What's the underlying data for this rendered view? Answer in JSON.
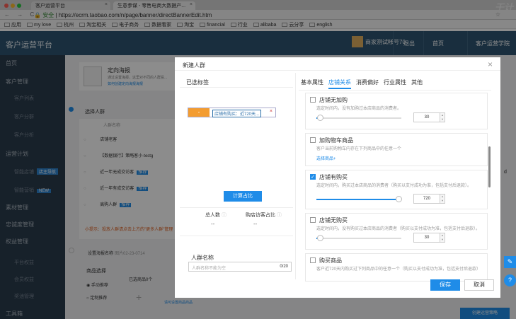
{
  "browser": {
    "tab1_title": "客户运营平台",
    "tab2_title": "生意参谋 - 零售电商大数据产...",
    "tab_close": "×",
    "nav_buttons": "← → C",
    "secure_label": "安全",
    "url": "https://ecrm.taobao.com/n/page/banner/directBannerEdit.htm",
    "watermark": "干计",
    "bookmarks": [
      "应用",
      "my love",
      "杭州",
      "淘宝相关",
      "电子商务",
      "数据看家",
      "淘宝",
      "financial",
      "行业",
      "alibaba",
      "云分享",
      "english"
    ]
  },
  "header": {
    "logo": "客户运营平台",
    "account": "商家测试帐号70",
    "logout": "退出",
    "home": "首页",
    "edu": "客户运营学院"
  },
  "sidebar": {
    "items": [
      {
        "label": "首页"
      },
      {
        "label": "客户管理"
      },
      {
        "label": "客户列表"
      },
      {
        "label": "客户分群"
      },
      {
        "label": "客户分析"
      },
      {
        "label": "运营计划"
      },
      {
        "label": "智能店铺",
        "tag": "店主导航"
      },
      {
        "label": "智能营销",
        "tag": "NEW"
      },
      {
        "label": "素材管理"
      },
      {
        "label": "忠诚度管理"
      },
      {
        "label": "权益管理"
      },
      {
        "label": "平台权益"
      },
      {
        "label": "会员权益"
      },
      {
        "label": "奖池管理"
      },
      {
        "label": "工具箱"
      }
    ]
  },
  "background": {
    "title": "定向海报",
    "desc": "通过设置海报，这里对不同的人群投...",
    "link": "如何创建定向海报海报",
    "select_crowd": "选择人群",
    "crowd_name_col": "人群名称",
    "rows": [
      "店铺老客",
      "【数据银行】策略客小-testg",
      "近一年无成交访客",
      "近一年有成交访客",
      "高购人群"
    ],
    "row_tags": [
      "",
      "",
      "推荐",
      "推荐",
      "推荐"
    ],
    "warn": "小提示：投放人群请点击上方的\"更多人群\"管理",
    "poster_name_label": "设置海报名称",
    "poster_name_value": "图片02-23-0714",
    "product_select": "商品选择",
    "manual": "手动推荐",
    "custom": "定制推荐",
    "selected": "已选商品0个",
    "edit_link": "请可设置商品商品",
    "create_btn": "创建运营策略",
    "side_letter": "d"
  },
  "modal": {
    "title": "新建人群",
    "close": "×",
    "selected_tags_title": "已选标签",
    "chip_tag": "店铺有购买：近720天...",
    "chip_remove": "×",
    "calc_button": "计算占比",
    "total_label": "总人数",
    "ratio_label": "购店访客占比",
    "total_value": "--",
    "ratio_value": "--",
    "name_label": "人群名称",
    "name_placeholder": "人群名称不能为空",
    "name_count": "0/20",
    "tabs": [
      "基本属性",
      "店铺关系",
      "消费偏好",
      "行业属性",
      "其他"
    ],
    "active_tab": 1,
    "cards": [
      {
        "name": "店铺无加购",
        "desc": "选定时间内，没有加购过本店商品的消费者。",
        "value": "30",
        "checked": false,
        "fill": 0.04
      },
      {
        "name": "加购物车商品",
        "desc": "客户当前购物车内存在下列商品中的任意一个",
        "link": "选择商品+",
        "checked": false
      },
      {
        "name": "店铺有购买",
        "desc": "选定时间内，购买过本店商品的消费者（购买以支付成功为准，包括支付后退款）。",
        "value": "720",
        "checked": true,
        "fill": 0.97
      },
      {
        "name": "店铺无购买",
        "desc": "选定时间内，没有购买过本店商品的消费者（购买以支付成功为准，包括支付后退款）。",
        "value": "30",
        "checked": false,
        "fill": 0.04
      },
      {
        "name": "购买商品",
        "desc": "客户近720天内购买过下列商品中的任意一个（购买以支付成功为准，包括支付后退款）",
        "checked": false
      }
    ],
    "save": "保存",
    "cancel": "取消"
  }
}
